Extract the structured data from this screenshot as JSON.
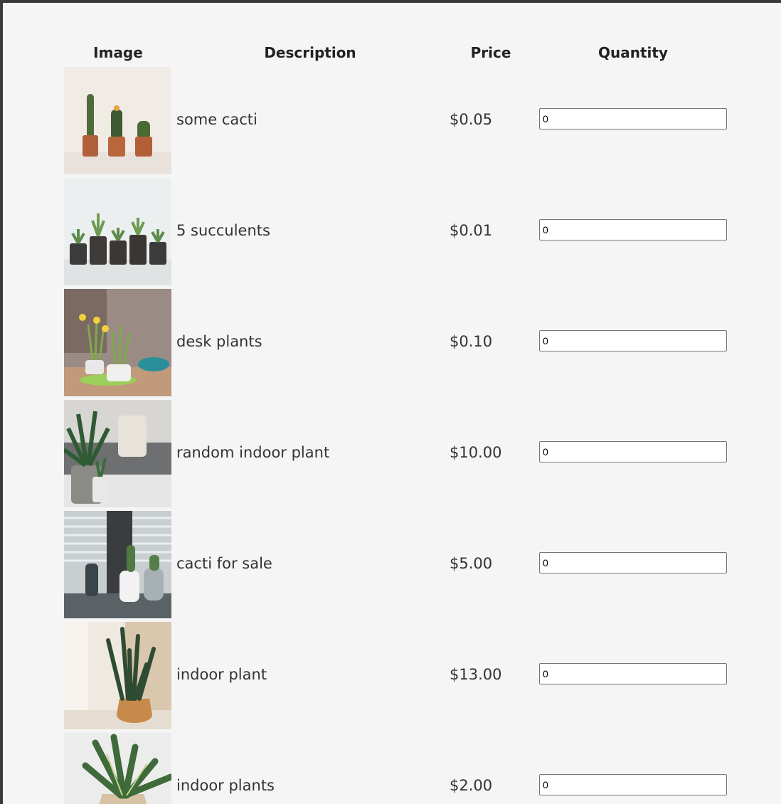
{
  "table": {
    "headers": {
      "image": "Image",
      "description": "Description",
      "price": "Price",
      "quantity": "Quantity"
    },
    "rows": [
      {
        "description": "some cacti",
        "price": "$0.05",
        "quantity": "0",
        "image_icon": "cacti-image"
      },
      {
        "description": "5 succulents",
        "price": "$0.01",
        "quantity": "0",
        "image_icon": "succulents-image"
      },
      {
        "description": "desk plants",
        "price": "$0.10",
        "quantity": "0",
        "image_icon": "desk-plants-image"
      },
      {
        "description": "random indoor plant",
        "price": "$10.00",
        "quantity": "0",
        "image_icon": "indoor-plant-image"
      },
      {
        "description": "cacti for sale",
        "price": "$5.00",
        "quantity": "0",
        "image_icon": "cacti-for-sale-image"
      },
      {
        "description": "indoor plant",
        "price": "$13.00",
        "quantity": "0",
        "image_icon": "snake-plant-image"
      },
      {
        "description": "indoor plants",
        "price": "$2.00",
        "quantity": "0",
        "image_icon": "indoor-plants-image"
      }
    ]
  }
}
